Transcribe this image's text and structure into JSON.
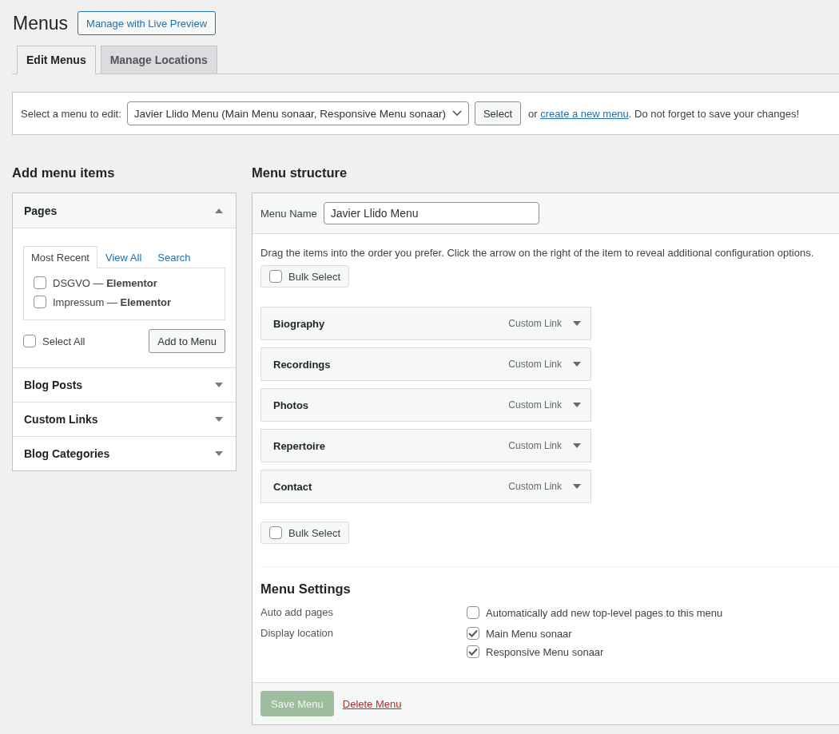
{
  "page": {
    "title": "Menus",
    "preview_button": "Manage with Live Preview"
  },
  "tabs": [
    {
      "label": "Edit Menus",
      "selected": true
    },
    {
      "label": "Manage Locations",
      "selected": false
    }
  ],
  "menu_select": {
    "label": "Select a menu to edit:",
    "value": "Javier Llido Menu (Main Menu sonaar, Responsive Menu sonaar)",
    "button": "Select",
    "text_before": "or ",
    "link": "create a new menu",
    "text_after": ". Do not forget to save your changes!"
  },
  "add_items": {
    "heading": "Add menu items",
    "panels": [
      {
        "title": "Pages",
        "expanded": true,
        "tabs": [
          {
            "label": "Most Recent",
            "selected": true
          },
          {
            "label": "View All",
            "selected": false
          },
          {
            "label": "Search",
            "selected": false
          }
        ],
        "items": [
          {
            "label": "DSGVO — **Elementor**",
            "checked": false
          },
          {
            "label": "Impressum — **Elementor**",
            "checked": false
          }
        ],
        "select_all": {
          "label": "Select All",
          "checked": false
        },
        "button": "Add to Menu"
      },
      {
        "title": "Blog Posts",
        "expanded": false
      },
      {
        "title": "Custom Links",
        "expanded": false
      },
      {
        "title": "Blog Categories",
        "expanded": false
      }
    ]
  },
  "structure": {
    "heading": "Menu structure",
    "name_label": "Menu Name",
    "name_value": "Javier Llido Menu",
    "instructions": "Drag the items into the order you prefer. Click the arrow on the right of the item to reveal additional configuration options.",
    "bulk_select_top": {
      "label": "Bulk Select",
      "checked": false
    },
    "items": [
      {
        "title": "Biography",
        "type": "Custom Link",
        "expanded": false
      },
      {
        "title": "Recordings",
        "type": "Custom Link",
        "expanded": false
      },
      {
        "title": "Photos",
        "type": "Custom Link",
        "expanded": false
      },
      {
        "title": "Repertoire",
        "type": "Custom Link",
        "expanded": false
      },
      {
        "title": "Contact",
        "type": "Custom Link",
        "expanded": false
      }
    ],
    "bulk_select_bottom": {
      "label": "Bulk Select",
      "checked": false
    },
    "settings": {
      "heading": "Menu Settings",
      "rows": [
        {
          "label": "Auto add pages",
          "options": [
            {
              "label": "Automatically add new top-level pages to this menu",
              "checked": false
            }
          ]
        },
        {
          "label": "Display location",
          "options": [
            {
              "label": "Main Menu sonaar",
              "checked": true
            },
            {
              "label": "Responsive Menu sonaar",
              "checked": true
            }
          ]
        }
      ]
    },
    "save_button": {
      "label": "Save Menu",
      "disabled": true
    },
    "delete_link": "Delete Menu"
  }
}
